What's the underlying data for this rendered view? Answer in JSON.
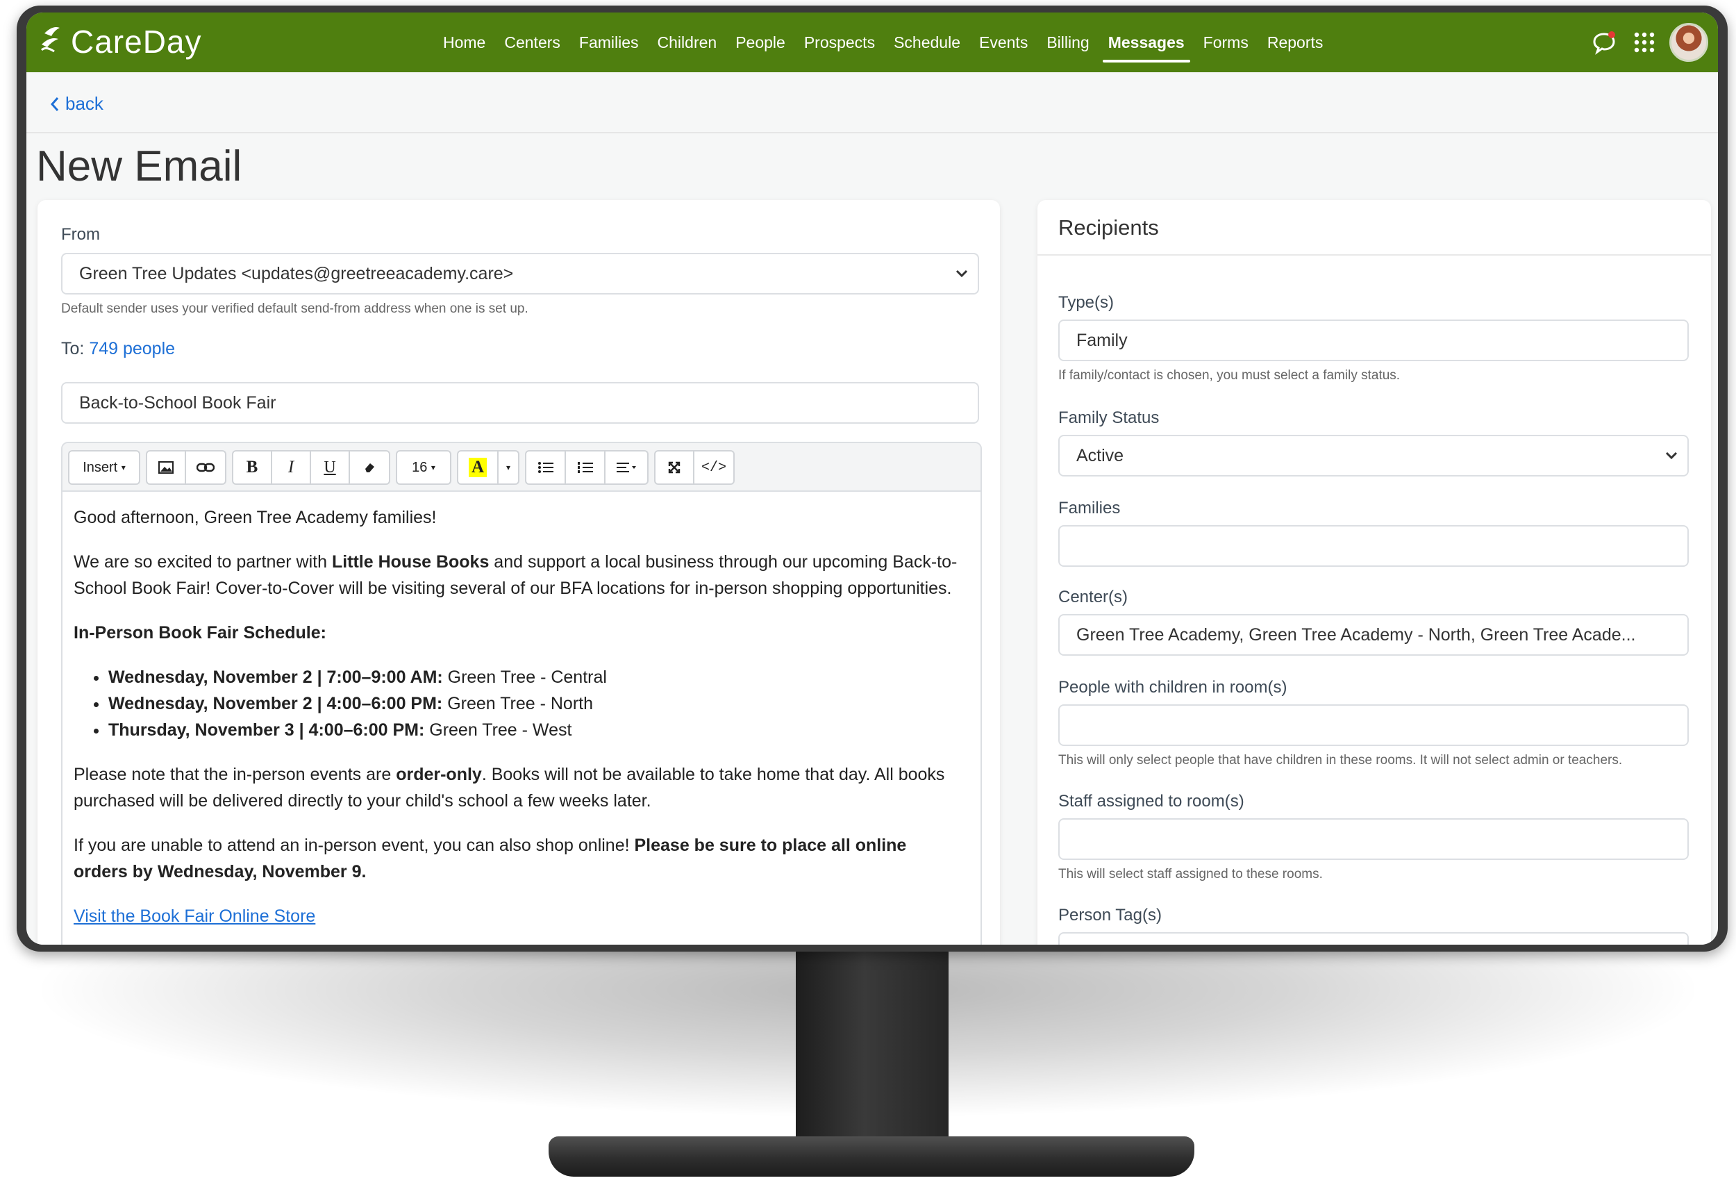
{
  "app": {
    "brand": "CareDay",
    "accent": "#4f7f0f",
    "link_color": "#1d6fd6"
  },
  "nav": {
    "items": [
      "Home",
      "Centers",
      "Families",
      "Children",
      "People",
      "Prospects",
      "Schedule",
      "Events",
      "Billing",
      "Messages",
      "Forms",
      "Reports"
    ],
    "active": "Messages"
  },
  "top_icons": [
    "chat-bubble-icon",
    "apps-grid-icon",
    "user-avatar"
  ],
  "back": {
    "label": "back"
  },
  "page": {
    "title": "New Email"
  },
  "email": {
    "from_label": "From",
    "from_value": "Green Tree Updates <updates@greetreeacademy.care>",
    "from_help": "Default sender uses your verified default send-from address when one is set up.",
    "to_label": "To:",
    "to_value": "749 people",
    "subject": "Back-to-School Book Fair"
  },
  "toolbar": {
    "insert": "Insert",
    "font_size": "16",
    "buttons": [
      "image-icon",
      "link-icon",
      "bold-icon",
      "italic-icon",
      "underline-icon",
      "eraser-icon",
      "highlight-icon",
      "bullet-list-icon",
      "numbered-list-icon",
      "align-icon",
      "fullscreen-icon",
      "code-view-icon"
    ]
  },
  "body": {
    "greeting": "Good afternoon, Green Tree Academy families!",
    "p1_a": "We are so excited to partner with ",
    "p1_b": "Little House Books",
    "p1_c": " and support a local business through our upcoming Back-to-School Book Fair! Cover-to-Cover will be visiting several of our BFA locations for in-person shopping opportunities.",
    "schedule_heading": "In-Person Book Fair Schedule:",
    "schedule": [
      {
        "when": "Wednesday, November 2 | 7:00–9:00 AM:",
        "where": " Green Tree - Central"
      },
      {
        "when": "Wednesday, November 2 | 4:00–6:00 PM:",
        "where": " Green Tree - North"
      },
      {
        "when": "Thursday, November 3 | 4:00–6:00 PM:",
        "where": " Green Tree - West"
      }
    ],
    "p2_a": "Please note that the in-person events are ",
    "p2_b": "order-only",
    "p2_c": ". Books will not be available to take home that day. All books purchased will be delivered directly to your child's school a few weeks later.",
    "p3_a": "If you are unable to attend an in-person event, you can also shop online! ",
    "p3_b": "Please be sure to place all online orders by Wednesday, November 9.",
    "link": "Visit the Book Fair Online Store"
  },
  "recipients": {
    "title": "Recipients",
    "types_label": "Type(s)",
    "types_value": "Family",
    "types_help": "If family/contact is chosen, you must select a family status.",
    "family_status_label": "Family Status",
    "family_status_value": "Active",
    "families_label": "Families",
    "families_value": "",
    "centers_label": "Center(s)",
    "centers_value": "Green Tree Academy, Green Tree Academy - North, Green Tree Acade...",
    "rooms_label": "People with children in room(s)",
    "rooms_value": "",
    "rooms_help": "This will only select people that have children in these rooms. It will not select admin or teachers.",
    "staff_label": "Staff assigned to room(s)",
    "staff_value": "",
    "staff_help": "This will select staff assigned to these rooms.",
    "tags_label": "Person Tag(s)",
    "tags_value": ""
  }
}
